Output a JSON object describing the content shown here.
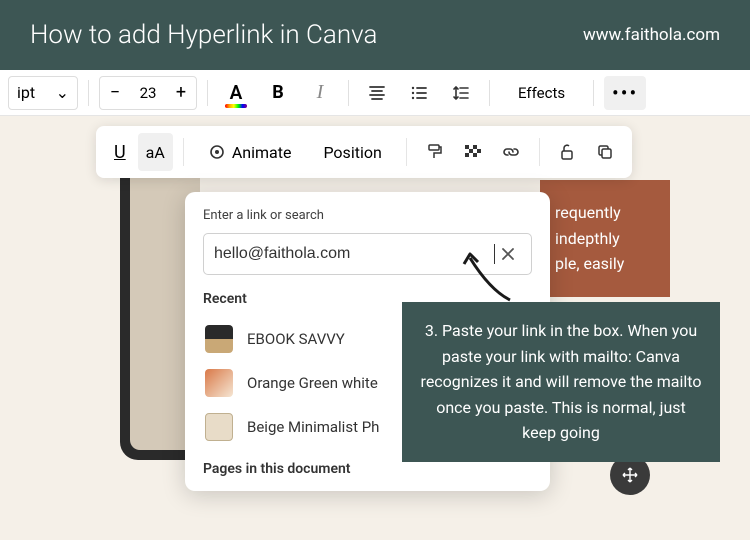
{
  "header": {
    "title": "How to add Hyperlink in Canva",
    "url": "www.faithola.com"
  },
  "toolbar1": {
    "font_name_partial": "ipt",
    "font_size": "23",
    "effects_label": "Effects"
  },
  "toolbar2": {
    "animate_label": "Animate",
    "position_label": "Position",
    "case_label": "aA"
  },
  "link_popup": {
    "label": "Enter a link or search",
    "input_value": "hello@faithola.com",
    "recent_label": "Recent",
    "recent_items": [
      {
        "name": "EBOOK SAVVY"
      },
      {
        "name": "Orange Green white"
      },
      {
        "name": "Beige Minimalist Ph"
      }
    ],
    "pages_label": "Pages in this document"
  },
  "brown_panel": {
    "line1": "requently",
    "line2": "indepthly",
    "line3": "ple, easily"
  },
  "instruction": {
    "text": "3. Paste your link in the box. When you paste your link with mailto: Canva recognizes it and will remove the mailto once you paste. This is normal, just keep going"
  }
}
